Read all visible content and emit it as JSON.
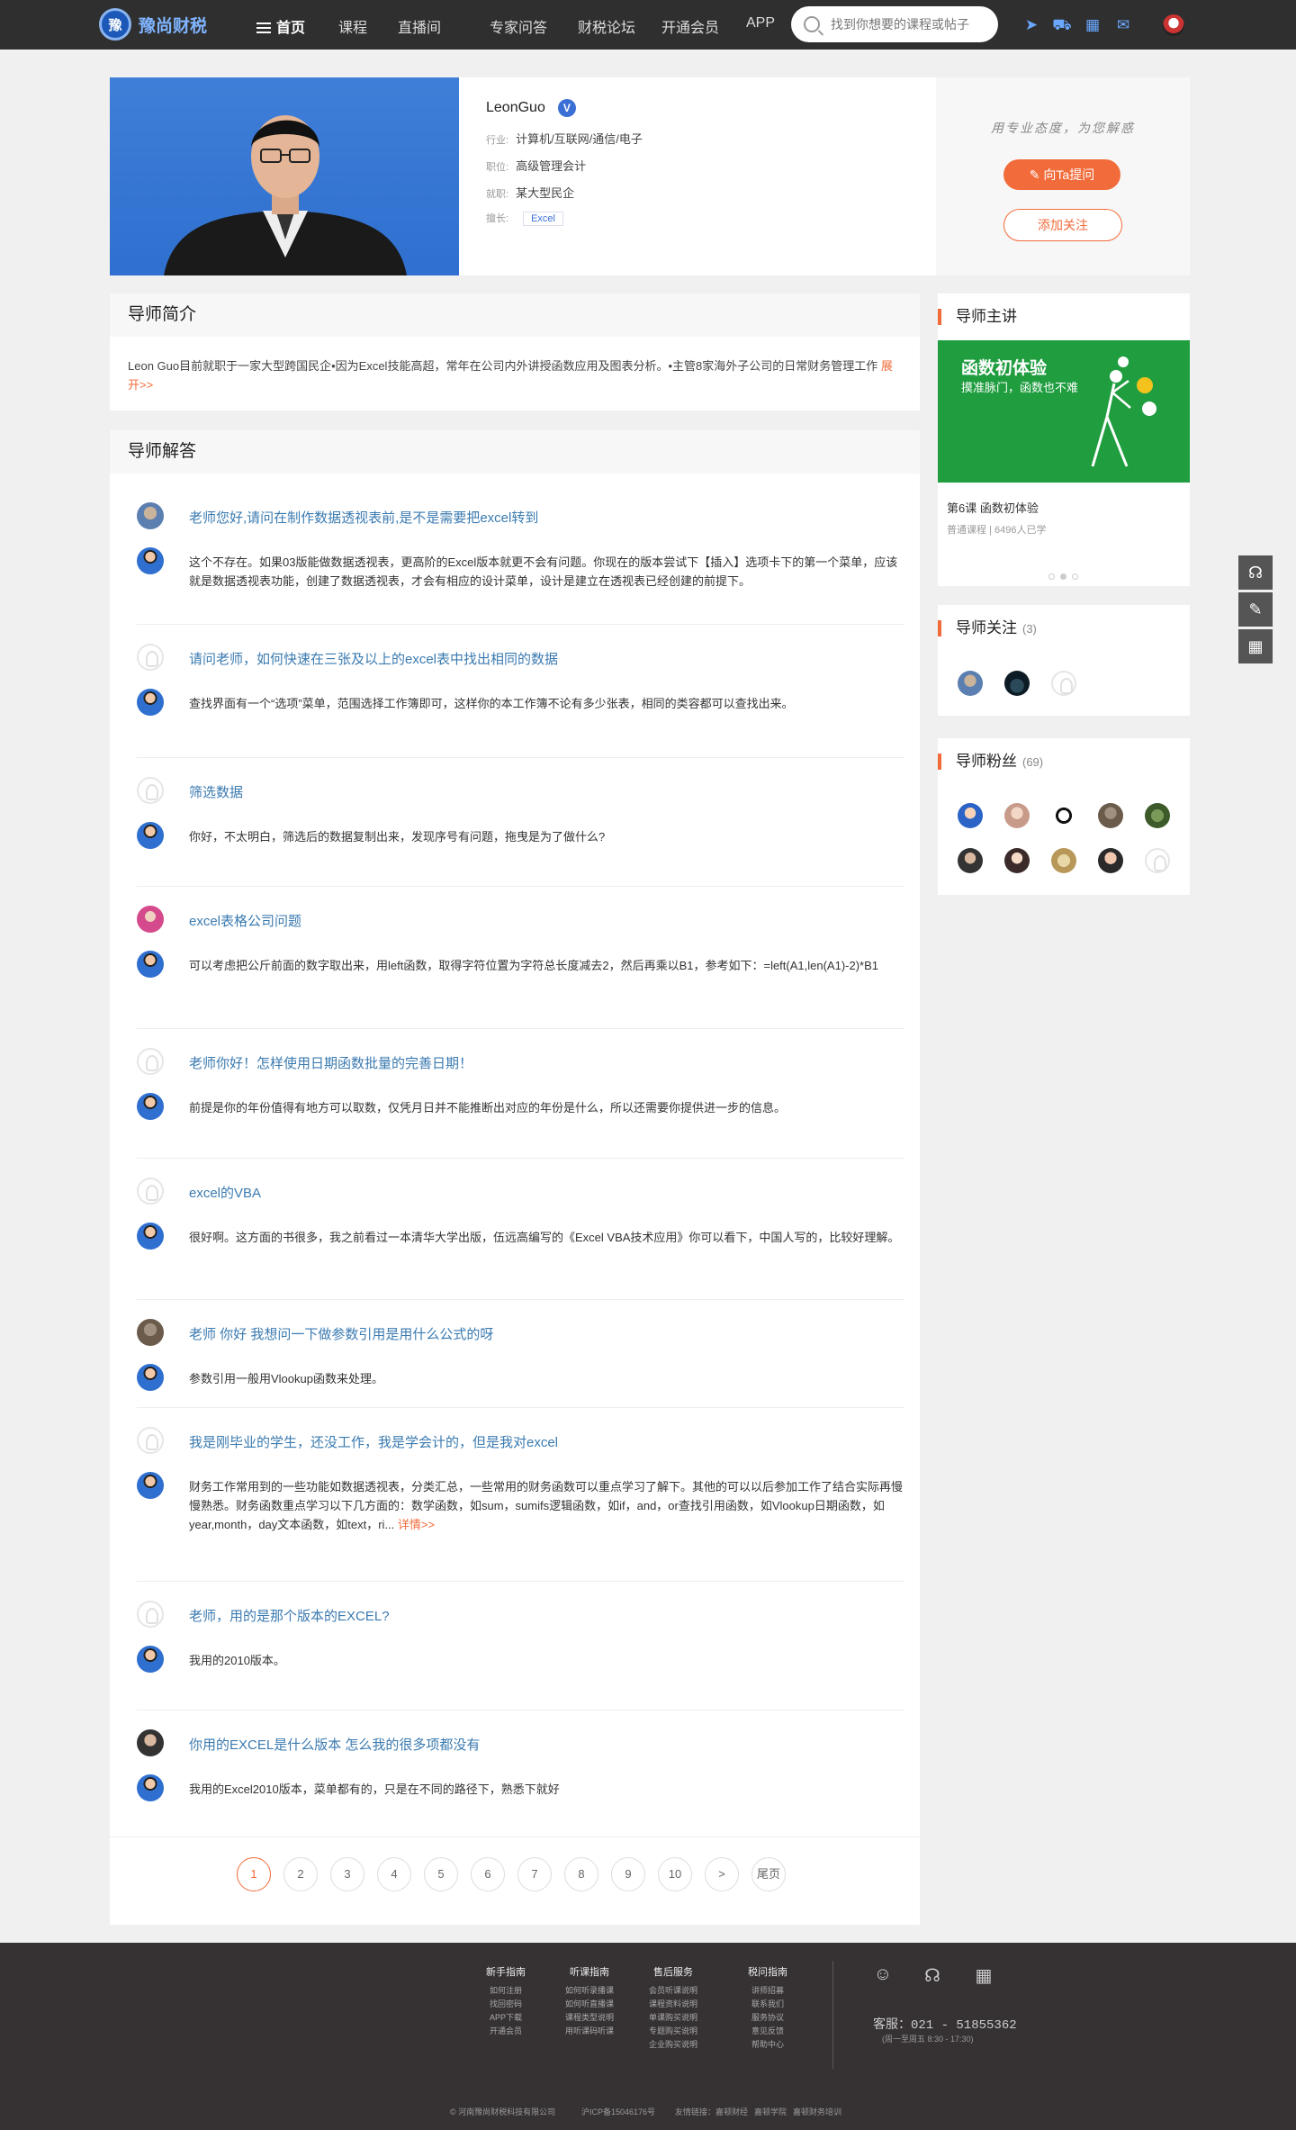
{
  "header": {
    "logo_text": "豫尚财税",
    "nav": [
      "首页",
      "课程",
      "直播间",
      "专家问答",
      "财税论坛",
      "开通会员",
      "APP"
    ],
    "search_placeholder": "找到你想要的课程或帖子"
  },
  "profile": {
    "name": "LeonGuo",
    "verified_badge": "V",
    "industry_label": "行业:",
    "industry": "计算机/互联网/通信/电子",
    "position_label": "职位:",
    "position": "高级管理会计",
    "employer_label": "就职:",
    "employer": "某大型民企",
    "skill_label": "擅长:",
    "skill_tag": "Excel",
    "motto": "用专业态度，为您解惑",
    "ask_button": "向Ta提问",
    "follow_button": "添加关注"
  },
  "intro": {
    "title": "导师简介",
    "text": "Leon Guo目前就职于一家大型跨国民企•因为Excel技能高超，常年在公司内外讲授函数应用及图表分析。•主管8家海外子公司的日常财务管理工作 ",
    "more": "展开>>"
  },
  "answers": {
    "title": "导师解答",
    "items": [
      {
        "q": "老师您好,请问在制作数据透视表前,是不是需要把excel转到",
        "a": "这个不存在。如果03版能做数据透视表，更高阶的Excel版本就更不会有问题。你现在的版本尝试下【插入】选项卡下的第一个菜单，应该就是数据透视表功能，创建了数据透视表，才会有相应的设计菜单，设计是建立在透视表已经创建的前提下。",
        "more": ""
      },
      {
        "q": "请问老师，如何快速在三张及以上的excel表中找出相同的数据",
        "a": "查找界面有一个“选项”菜单，范围选择工作簿即可，这样你的本工作簿不论有多少张表，相同的类容都可以查找出来。",
        "more": ""
      },
      {
        "q": "筛选数据",
        "a": "你好，不太明白，筛选后的数据复制出来，发现序号有问题，拖曳是为了做什么?",
        "more": ""
      },
      {
        "q": "excel表格公司问题",
        "a": "可以考虑把公斤前面的数字取出来，用left函数，取得字符位置为字符总长度减去2，然后再乘以B1，参考如下：=left(A1,len(A1)-2)*B1",
        "more": ""
      },
      {
        "q": "老师你好！怎样使用日期函数批量的完善日期！",
        "a": "前提是你的年份值得有地方可以取数，仅凭月日并不能推断出对应的年份是什么，所以还需要你提供进一步的信息。",
        "more": ""
      },
      {
        "q": "excel的VBA",
        "a": "很好啊。这方面的书很多，我之前看过一本清华大学出版，伍远高编写的《Excel VBA技术应用》你可以看下，中国人写的，比较好理解。",
        "more": ""
      },
      {
        "q": "老师 你好 我想问一下做参数引用是用什么公式的呀",
        "a": "参数引用一般用Vlookup函数来处理。",
        "more": ""
      },
      {
        "q": "我是刚毕业的学生，还没工作，我是学会计的，但是我对excel",
        "a": "财务工作常用到的一些功能如数据透视表，分类汇总，一些常用的财务函数可以重点学习了解下。其他的可以以后参加工作了结合实际再慢慢熟悉。财务函数重点学习以下几方面的：数学函数，如sum，sumifs逻辑函数，如if，and，or查找引用函数，如Vlookup日期函数，如year,month，day文本函数，如text，ri... ",
        "more": "详情>>"
      },
      {
        "q": "老师，用的是那个版本的EXCEL?",
        "a": "我用的2010版本。",
        "more": ""
      },
      {
        "q": "你用的EXCEL是什么版本 怎么我的很多项都没有",
        "a": "我用的Excel2010版本，菜单都有的，只是在不同的路径下，熟悉下就好",
        "more": ""
      }
    ]
  },
  "pagination": [
    "1",
    "2",
    "3",
    "4",
    "5",
    "6",
    "7",
    "8",
    "9",
    "10",
    ">",
    "尾页"
  ],
  "course": {
    "title": "导师主讲",
    "banner_title": "函数初体验",
    "banner_sub": "摸准脉门，函数也不难",
    "name": "第6课 函数初体验",
    "meta": "普通课程  |  6496人已学"
  },
  "follows": {
    "title": "导师关注",
    "count": "(3)"
  },
  "fans": {
    "title": "导师粉丝",
    "count": "(69)"
  },
  "footer": {
    "cols": [
      {
        "title": "新手指南",
        "links": [
          "如何注册",
          "找回密码",
          "APP下载",
          "开通会员"
        ]
      },
      {
        "title": "听课指南",
        "links": [
          "如何听录播课",
          "如何听直播课",
          "课程类型说明",
          "用听课码听课"
        ]
      },
      {
        "title": "售后服务",
        "links": [
          "会员听课说明",
          "课程资料说明",
          "单课购买说明",
          "专题购买说明",
          "企业购买说明"
        ]
      },
      {
        "title": "税问指南",
        "links": [
          "讲师招募",
          "联系我们",
          "服务协议",
          "意见反馈",
          "帮助中心"
        ]
      }
    ],
    "phone": "客服：021 - 51855362",
    "hours": "(周一至周五  8:30 - 17:30)",
    "copyright": "© 河南豫尚财税科技有限公司",
    "icp": "沪ICP备15046176号",
    "friends_label": "友情链接：",
    "friends": [
      "嘉顿财经",
      "嘉顿学院",
      "嘉顿财务培训"
    ]
  }
}
